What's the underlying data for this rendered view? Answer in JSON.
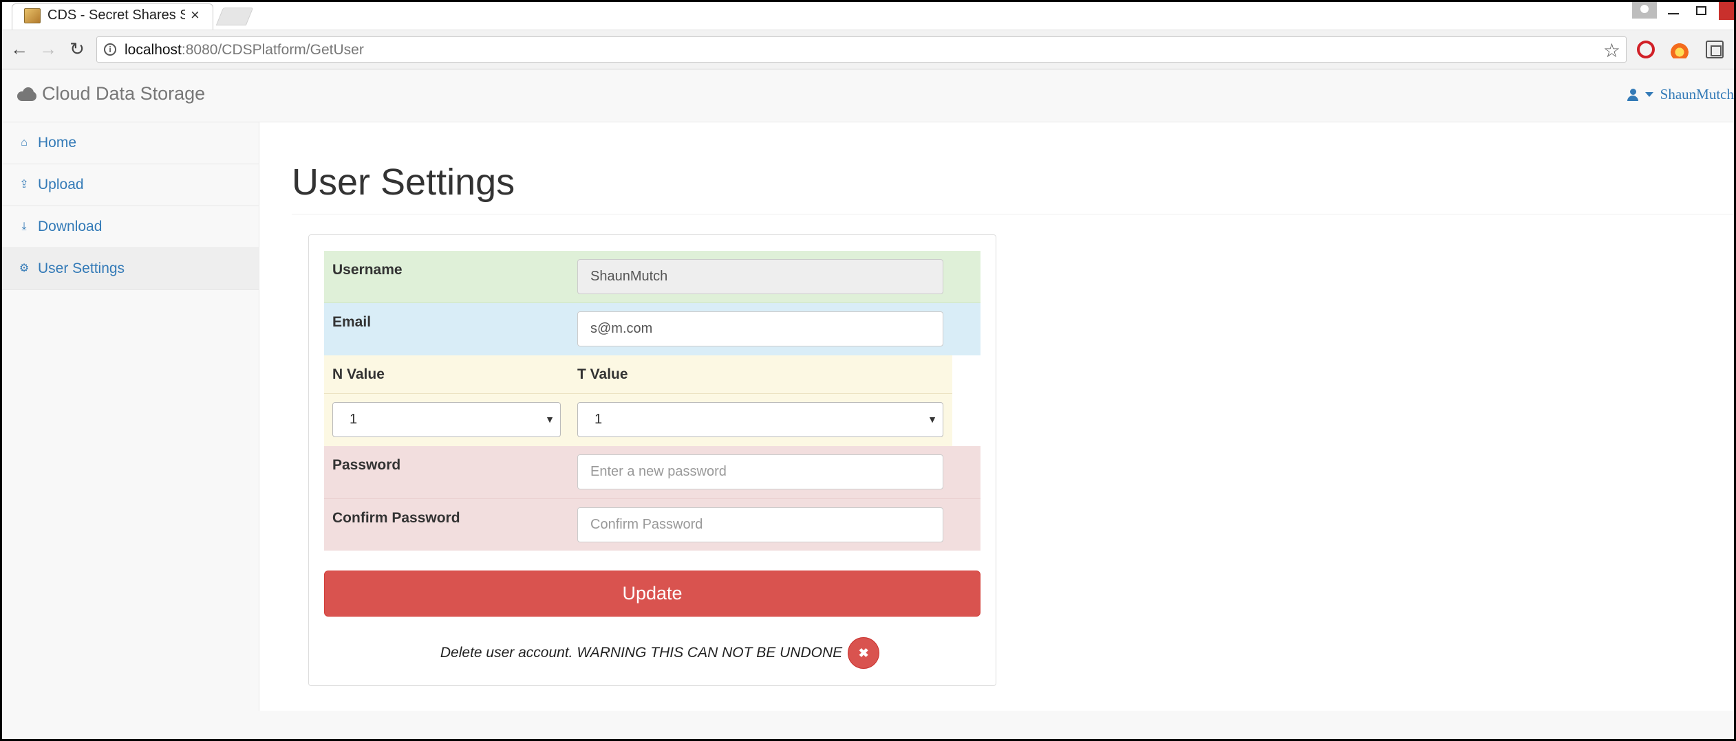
{
  "browser": {
    "tab_title": "CDS - Secret Shares Syste",
    "tab_close": "×",
    "url_host": "localhost",
    "url_rest": ":8080/CDSPlatform/GetUser"
  },
  "navbar": {
    "brand": "Cloud Data Storage",
    "username": "ShaunMutch"
  },
  "sidebar": {
    "items": [
      {
        "label": "Home",
        "icon": "home-icon"
      },
      {
        "label": "Upload",
        "icon": "upload-icon"
      },
      {
        "label": "Download",
        "icon": "download-icon"
      },
      {
        "label": "User Settings",
        "icon": "gear-icon"
      }
    ]
  },
  "main": {
    "title": "User Settings",
    "form": {
      "username_label": "Username",
      "username_value": "ShaunMutch",
      "email_label": "Email",
      "email_value": "s@m.com",
      "n_label": "N Value",
      "t_label": "T Value",
      "n_value": "1",
      "t_value": "1",
      "password_label": "Password",
      "password_placeholder": "Enter a new password",
      "confirm_label": "Confirm Password",
      "confirm_placeholder": "Confirm Password",
      "update_label": "Update",
      "delete_text": "Delete user account. WARNING THIS CAN NOT BE UNDONE",
      "delete_icon": "✖"
    }
  },
  "colors": {
    "link": "#337ab7",
    "danger": "#d9534f",
    "success_row": "#dff0d8",
    "info_row": "#d9edf7",
    "warning_row": "#fcf8e3",
    "danger_row": "#f2dede"
  }
}
